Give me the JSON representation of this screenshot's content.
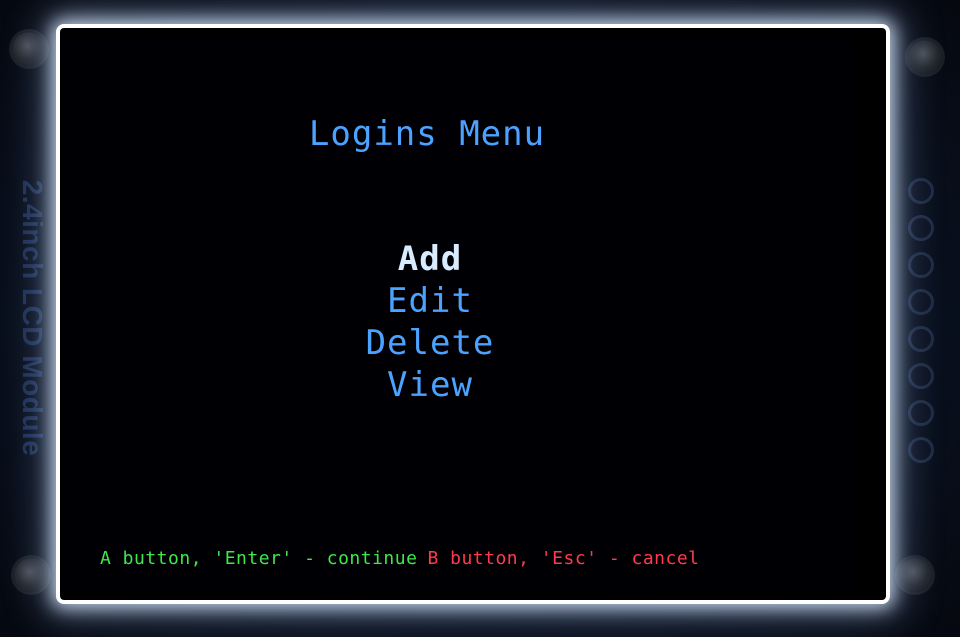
{
  "device": {
    "module_label": "2.4inch LCD Module"
  },
  "screen": {
    "title": "Logins Menu",
    "menu": {
      "items": [
        {
          "label": "Add",
          "selected": true
        },
        {
          "label": "Edit",
          "selected": false
        },
        {
          "label": "Delete",
          "selected": false
        },
        {
          "label": "View",
          "selected": false
        }
      ]
    },
    "footer": {
      "continue_hint": "A button, 'Enter' - continue",
      "cancel_hint": "B button, 'Esc' - cancel"
    }
  },
  "colors": {
    "title": "#4ba3ff",
    "menu_item": "#4ba3ff",
    "menu_item_selected": "#d8ebff",
    "continue_hint": "#3ee84a",
    "cancel_hint": "#ff3a4d",
    "background": "#000004"
  }
}
